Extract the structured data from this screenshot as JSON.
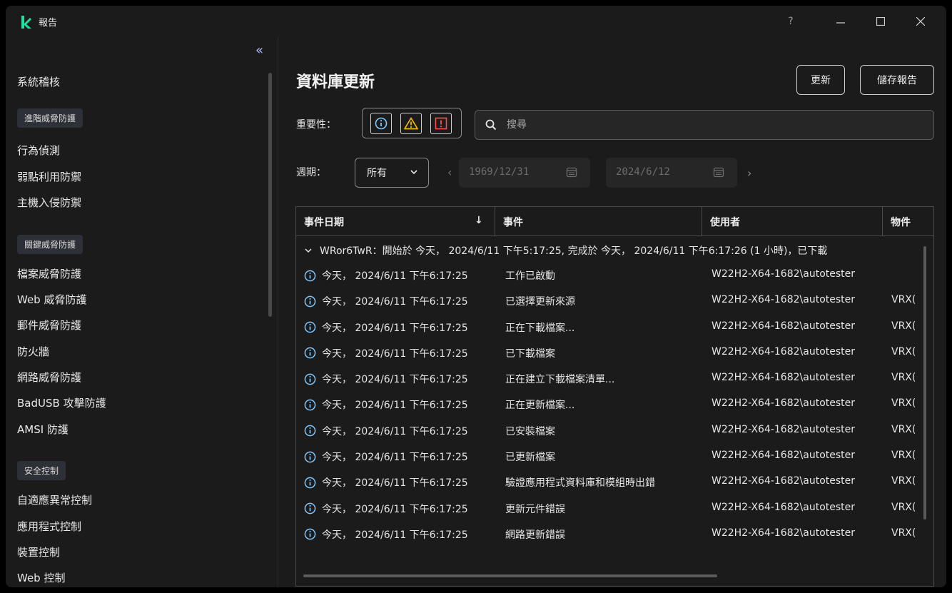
{
  "window": {
    "title": "報告",
    "help_label": "?"
  },
  "sidebar": {
    "items_top": [
      "系統稽核"
    ],
    "section1": "進階威脅防護",
    "section1_items": [
      "行為偵測",
      "弱點利用防禦",
      "主機入侵防禦"
    ],
    "section2": "關鍵威脅防護",
    "section2_items": [
      "檔案威脅防護",
      "Web 威脅防護",
      "郵件威脅防護",
      "防火牆",
      "網路威脅防護",
      "BadUSB 攻擊防護",
      "AMSI 防護"
    ],
    "section3": "安全控制",
    "section3_items": [
      "自適應異常控制",
      "應用程式控制",
      "裝置控制",
      "Web 控制"
    ]
  },
  "main": {
    "title": "資料庫更新",
    "update_button": "更新",
    "save_button": "儲存報告",
    "severity_label": "重要性：",
    "search_placeholder": "搜尋",
    "period_label": "週期：",
    "period_value": "所有",
    "date_from": "1969/12/31",
    "date_to": "2024/6/12"
  },
  "table": {
    "columns": [
      "事件日期",
      "事件",
      "使用者",
      "物件"
    ],
    "group_header": "WRor6TwR：開始於 今天， 2024/6/11 下午5:17:25, 完成於 今天， 2024/6/11 下午6:17:26 (1 小時)，已下載",
    "rows": [
      {
        "date": "今天， 2024/6/11 下午6:17:25",
        "event": "工作已啟動",
        "user": "W22H2-X64-1682\\autotester",
        "object": ""
      },
      {
        "date": "今天， 2024/6/11 下午6:17:25",
        "event": "已選擇更新來源",
        "user": "W22H2-X64-1682\\autotester",
        "object": "VRX("
      },
      {
        "date": "今天， 2024/6/11 下午6:17:25",
        "event": "正在下載檔案...",
        "user": "W22H2-X64-1682\\autotester",
        "object": "VRX("
      },
      {
        "date": "今天， 2024/6/11 下午6:17:25",
        "event": "已下載檔案",
        "user": "W22H2-X64-1682\\autotester",
        "object": "VRX("
      },
      {
        "date": "今天， 2024/6/11 下午6:17:25",
        "event": "正在建立下載檔案清單...",
        "user": "W22H2-X64-1682\\autotester",
        "object": "VRX("
      },
      {
        "date": "今天， 2024/6/11 下午6:17:25",
        "event": "正在更新檔案...",
        "user": "W22H2-X64-1682\\autotester",
        "object": "VRX("
      },
      {
        "date": "今天， 2024/6/11 下午6:17:25",
        "event": "已安裝檔案",
        "user": "W22H2-X64-1682\\autotester",
        "object": "VRX("
      },
      {
        "date": "今天， 2024/6/11 下午6:17:25",
        "event": "已更新檔案",
        "user": "W22H2-X64-1682\\autotester",
        "object": "VRX("
      },
      {
        "date": "今天， 2024/6/11 下午6:17:25",
        "event": "驗證應用程式資料庫和模組時出錯",
        "user": "W22H2-X64-1682\\autotester",
        "object": "VRX("
      },
      {
        "date": "今天， 2024/6/11 下午6:17:25",
        "event": "更新元件錯誤",
        "user": "W22H2-X64-1682\\autotester",
        "object": "VRX("
      },
      {
        "date": "今天， 2024/6/11 下午6:17:25",
        "event": "網路更新錯誤",
        "user": "W22H2-X64-1682\\autotester",
        "object": "VRX("
      }
    ]
  },
  "colors": {
    "brand_green": "#1ee1a0",
    "info_blue": "#7ec8ff",
    "warning_yellow": "#f5b800",
    "error_red": "#ff4d4d",
    "accent_link": "#b8c0ff"
  }
}
